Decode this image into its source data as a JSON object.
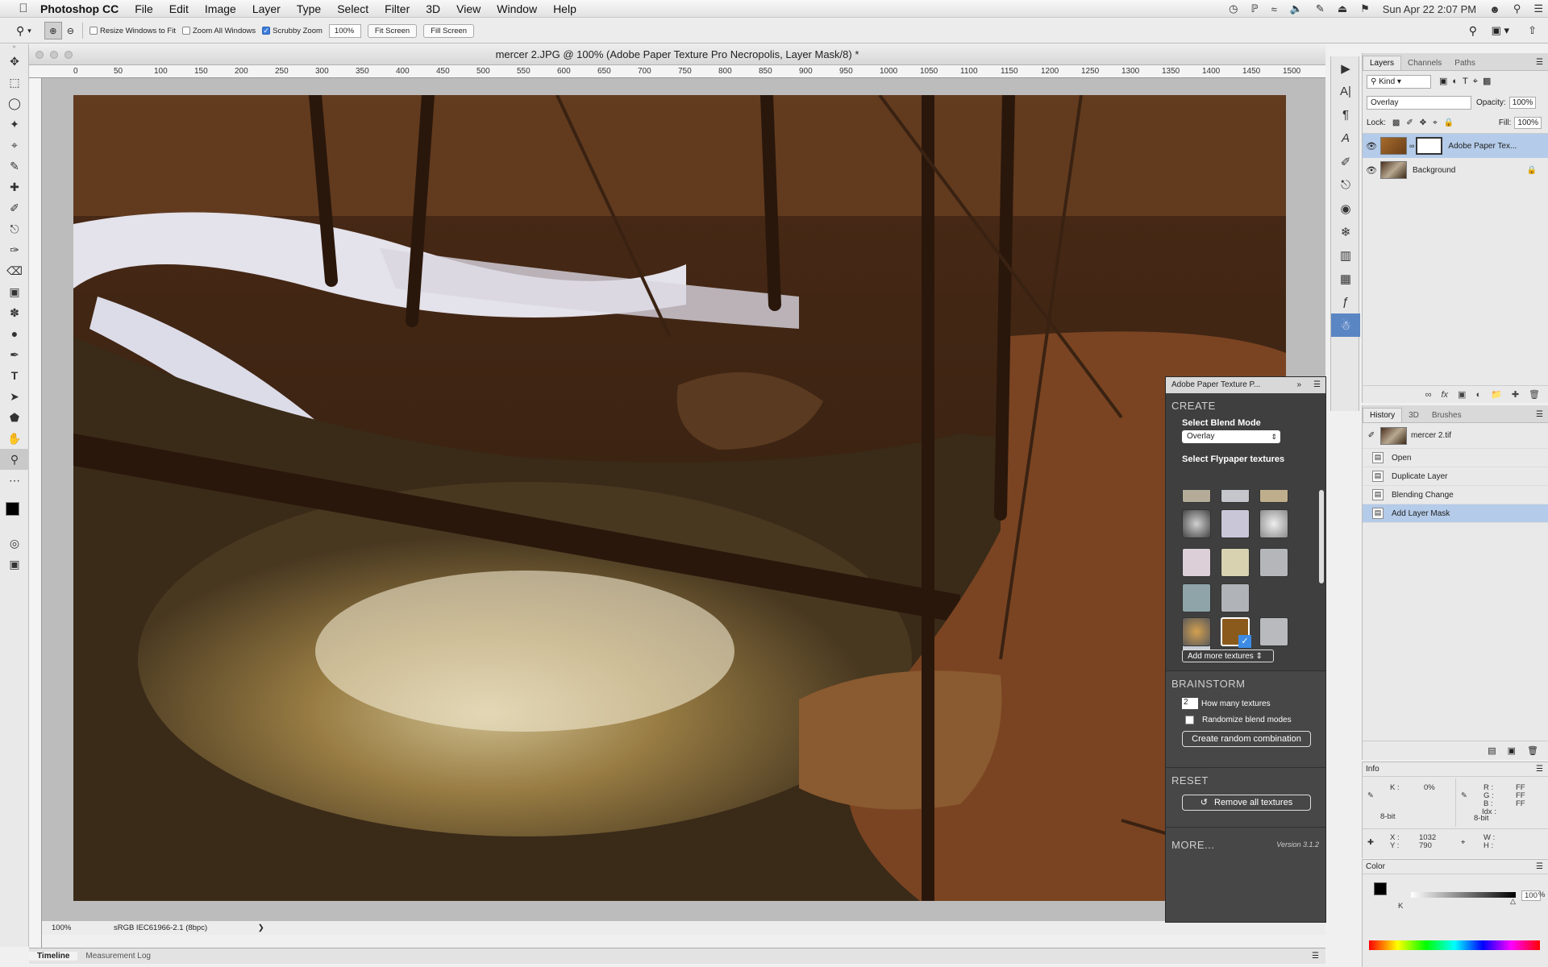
{
  "menubar": {
    "app_name": "Photoshop CC",
    "items": [
      "File",
      "Edit",
      "Image",
      "Layer",
      "Type",
      "Select",
      "Filter",
      "3D",
      "View",
      "Window",
      "Help"
    ],
    "clock": "Sun Apr 22  2:07 PM"
  },
  "options": {
    "resize_windows": "Resize Windows to Fit",
    "zoom_all": "Zoom All Windows",
    "scrubby": "Scrubby Zoom",
    "zoom_value": "100%",
    "fit_screen": "Fit Screen",
    "fill_screen": "Fill Screen"
  },
  "document": {
    "title": "mercer 2.JPG @ 100% (Adobe Paper Texture Pro Necropolis, Layer Mask/8) *",
    "ruler_ticks": [
      "0",
      "50",
      "100",
      "150",
      "200",
      "250",
      "300",
      "350",
      "400",
      "450",
      "500",
      "550",
      "600",
      "650",
      "700",
      "750",
      "800",
      "850",
      "900",
      "950",
      "1000",
      "1050",
      "1100",
      "1150",
      "1200",
      "1250",
      "1300",
      "1350",
      "1400",
      "1450",
      "1500"
    ],
    "zoom": "100%",
    "profile": "sRGB IEC61966-2.1 (8bpc)"
  },
  "timeline": {
    "tab1": "Timeline",
    "tab2": "Measurement Log"
  },
  "plugin": {
    "title": "Adobe Paper Texture P...",
    "create": "CREATE",
    "select_blend_mode": "Select Blend Mode",
    "blend_value": "Overlay",
    "select_textures": "Select Flypaper textures",
    "add_more": "Add more textures",
    "brainstorm": "BRAINSTORM",
    "how_many_value": "2",
    "how_many_label": "How many textures",
    "randomize": "Randomize blend modes",
    "create_random": "Create random combination",
    "reset": "RESET",
    "remove_all": "Remove all textures",
    "more": "MORE...",
    "version": "Version 3.1.2"
  },
  "layers": {
    "tabs": [
      "Layers",
      "Channels",
      "Paths"
    ],
    "kind": "Kind",
    "blend": "Overlay",
    "opacity_label": "Opacity:",
    "opacity_value": "100%",
    "lock_label": "Lock:",
    "fill_label": "Fill:",
    "fill_value": "100%",
    "items": [
      {
        "name": "Adobe Paper Tex...",
        "selected": true
      },
      {
        "name": "Background",
        "selected": false
      }
    ]
  },
  "history": {
    "tabs": [
      "History",
      "3D",
      "Brushes"
    ],
    "snapshot": "mercer 2.tif",
    "steps": [
      "Open",
      "Duplicate Layer",
      "Blending Change",
      "Add Layer Mask"
    ]
  },
  "info": {
    "title": "Info",
    "k_label": "K :",
    "k_value": "0%",
    "bit_left": "8-bit",
    "r_label": "R :",
    "g_label": "G :",
    "b_label": "B :",
    "r_value": "FF",
    "g_value": "FF",
    "b_value": "FF",
    "idx_label": "Idx :",
    "bit_right": "8-bit",
    "x_label": "X :",
    "x_value": "1032",
    "y_label": "Y :",
    "y_value": "790",
    "w_label": "W :",
    "h_label": "H :"
  },
  "color": {
    "title": "Color",
    "k_label": "K",
    "k_value": "100",
    "percent": "%"
  }
}
